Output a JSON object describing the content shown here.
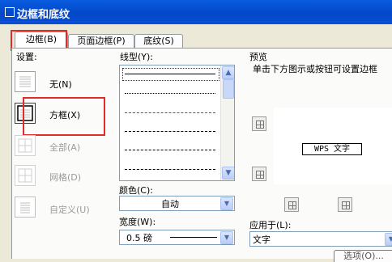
{
  "title": "边框和底纹",
  "tabs": [
    {
      "label": "边框(B)",
      "active": true
    },
    {
      "label": "页面边框(P)",
      "active": false
    },
    {
      "label": "底纹(S)",
      "active": false
    }
  ],
  "settings": {
    "label": "设置:",
    "items": [
      {
        "label": "无(N)"
      },
      {
        "label": "方框(X)"
      },
      {
        "label": "全部(A)"
      },
      {
        "label": "网格(D)"
      },
      {
        "label": "自定义(U)"
      }
    ]
  },
  "line_style": {
    "label": "线型(Y):"
  },
  "color": {
    "label": "颜色(C):",
    "value": "自动"
  },
  "width": {
    "label": "宽度(W):",
    "value": "0.5 磅"
  },
  "preview": {
    "label": "预览",
    "hint": "单击下方图示或按钮可设置边框",
    "sample_text": "WPS 文字"
  },
  "apply_to": {
    "label": "应用于(L):",
    "value": "文字"
  },
  "options_button": {
    "label": "选项(O)..."
  },
  "colors": {
    "titlebar": "#0348c8",
    "highlight": "#e12b2b",
    "dialog_bg": "#ece9d8"
  }
}
